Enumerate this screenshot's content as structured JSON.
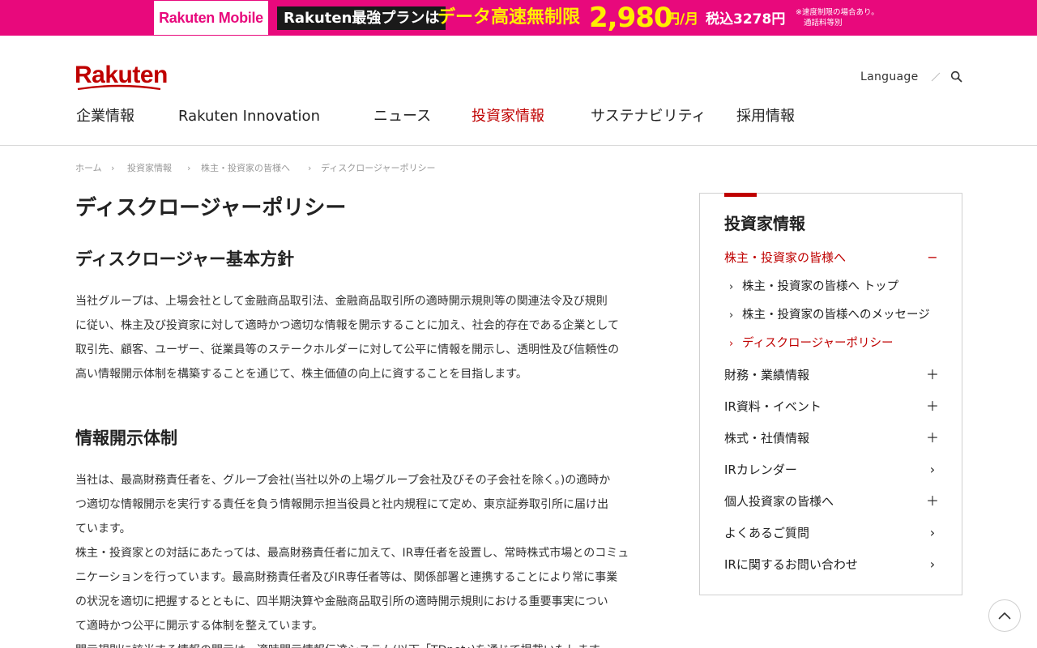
{
  "banner": {
    "brand": "Rakuten Mobile",
    "plan": "Rakuten最強プランは",
    "headline": "データ高速無制限",
    "price": "2,980",
    "unit": "円/月",
    "tax": "税込3278円",
    "note_line1": "※速度制限の場合あり。",
    "note_line2": "通話料等別",
    "colors": {
      "background": "#e8097c",
      "accent": "#ffee00"
    }
  },
  "header": {
    "logo": "Rakuten",
    "language": "Language",
    "search_icon": "search-icon",
    "nav": [
      {
        "label": "企業情報",
        "active": false
      },
      {
        "label": "Rakuten Innovation",
        "active": false
      },
      {
        "label": "ニュース",
        "active": false
      },
      {
        "label": "投資家情報",
        "active": true
      },
      {
        "label": "サステナビリティ",
        "active": false
      },
      {
        "label": "採用情報",
        "active": false
      }
    ],
    "brand_color": "#bf0000"
  },
  "breadcrumb": [
    "ホーム",
    "投資家情報",
    "株主・投資家の皆様へ",
    "ディスクロージャーポリシー"
  ],
  "main": {
    "title": "ディスクロージャーポリシー",
    "sections": [
      {
        "heading": "ディスクロージャー基本方針",
        "lines": [
          "当社グループは、上場会社として金融商品取引法、金融商品取引所の適時開示規則等の関連法令及び規則",
          "に従い、株主及び投資家に対して適時かつ適切な情報を開示することに加え、社会的存在である企業として",
          "取引先、顧客、ユーザー、従業員等のステークホルダーに対して公平に情報を開示し、透明性及び信頼性の",
          "高い情報開示体制を構築することを通じて、株主価値の向上に資することを目指します。"
        ]
      },
      {
        "heading": "情報開示体制",
        "lines": [
          "当社は、最高財務責任者を、グループ会社(当社以外の上場グループ会社及びその子会社を除く。)の適時か",
          "つ適切な情報開示を実行する責任を負う情報開示担当役員と社内規程にて定め、東京証券取引所に届け出",
          "ています。",
          "株主・投資家との対話にあたっては、最高財務責任者に加えて、IR専任者を設置し、常時株式市場とのコミュ",
          "ニケーションを行っています。最高財務責任者及びIR専任者等は、関係部署と連携することにより常に事業",
          "の状況を適切に把握するとともに、四半期決算や金融商品取引所の適時開示規則における重要事実につい",
          "て適時かつ公平に開示する体制を整えています。",
          "開示規則に該当する情報の開示は、適時開示情報伝達システム(以下「TDnet」)を通じて掲載いたします。"
        ]
      }
    ]
  },
  "sidebar": {
    "title": "投資家情報",
    "section": {
      "label": "株主・投資家の皆様へ",
      "mark": "−"
    },
    "sub_items": [
      {
        "label": "株主・投資家の皆様へ トップ",
        "current": false
      },
      {
        "label": "株主・投資家の皆様へのメッセージ",
        "current": false
      },
      {
        "label": "ディスクロージャーポリシー",
        "current": true
      }
    ],
    "items": [
      {
        "label": "財務・業績情報",
        "mark": "＋"
      },
      {
        "label": "IR資料・イベント",
        "mark": "＋"
      },
      {
        "label": "株式・社債情報",
        "mark": "＋"
      },
      {
        "label": "IRカレンダー",
        "mark": "›"
      },
      {
        "label": "個人投資家の皆様へ",
        "mark": "＋"
      },
      {
        "label": "よくあるご質問",
        "mark": "›"
      },
      {
        "label": "IRに関するお問い合わせ",
        "mark": "›"
      }
    ]
  },
  "scroll_top": "chevron-up-icon"
}
